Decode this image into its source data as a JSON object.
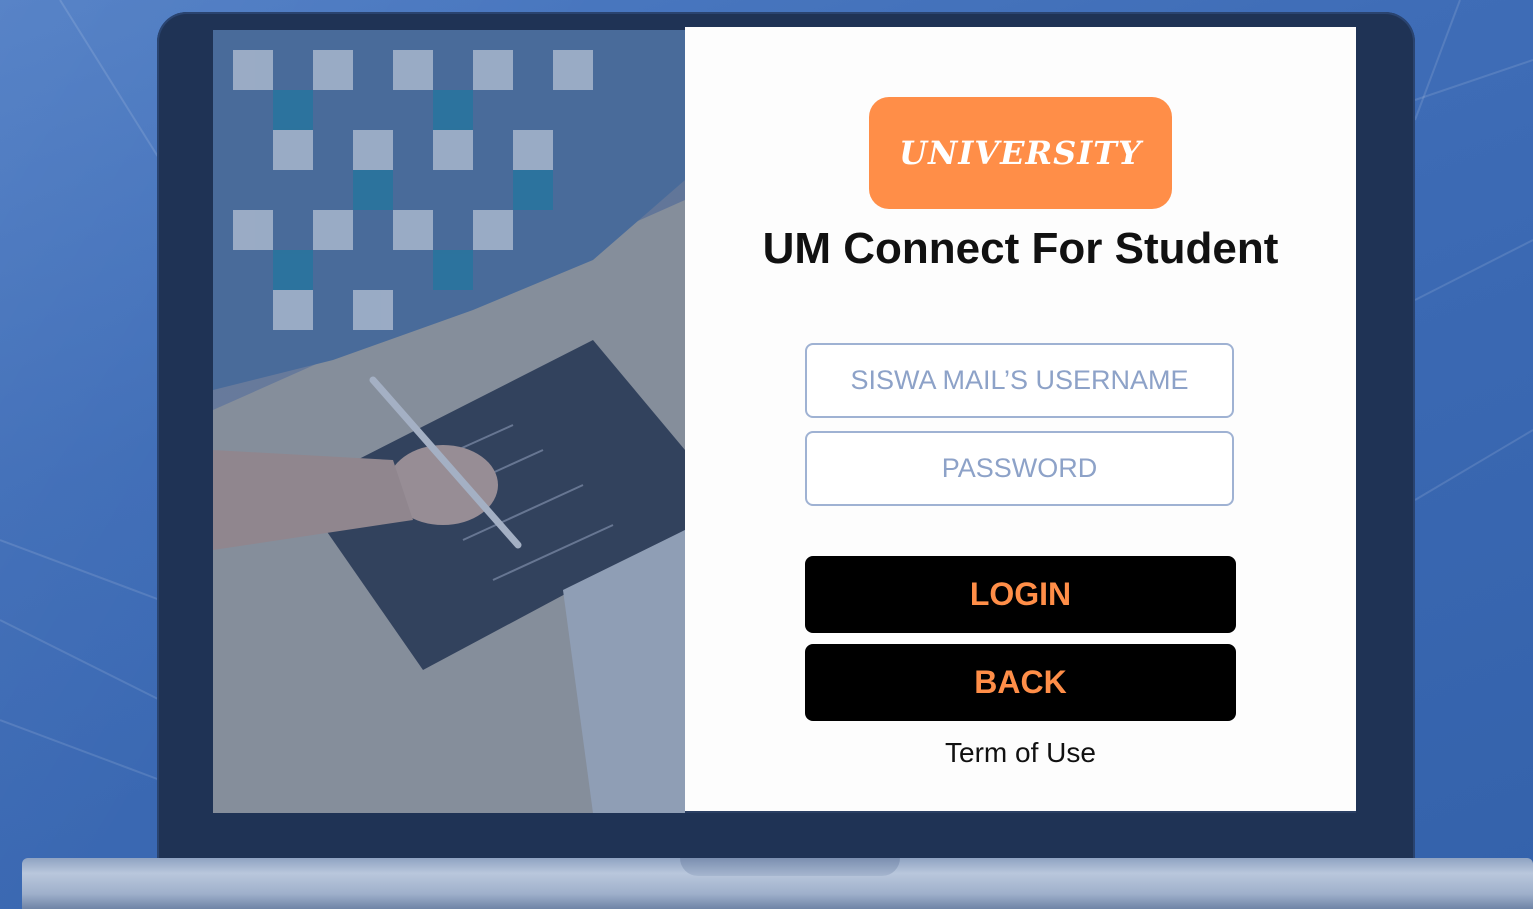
{
  "logo": {
    "text": "UNIVERSITY"
  },
  "title": "UM Connect For Student",
  "form": {
    "username_placeholder": "SISWA MAIL’S USERNAME",
    "password_placeholder": "PASSWORD"
  },
  "buttons": {
    "login_label": "LOGIN",
    "back_label": "BACK"
  },
  "footer": {
    "terms_label": "Term of Use"
  },
  "colors": {
    "accent": "#ff8e48",
    "button_bg": "#000000",
    "field_border": "#9fb2d3",
    "background": "#3f6db7"
  }
}
